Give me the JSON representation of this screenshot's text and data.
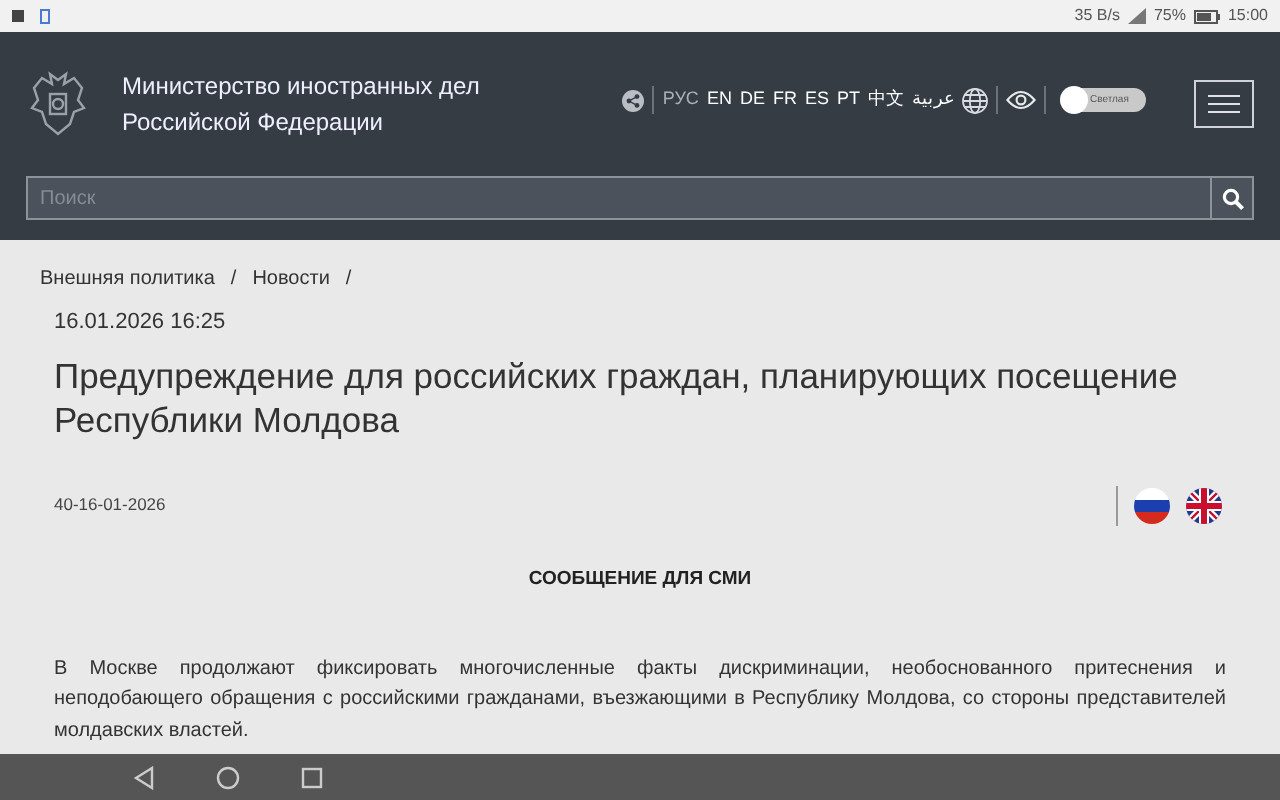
{
  "status_bar": {
    "speed": "35 B/s",
    "battery": "75%",
    "time": "15:00"
  },
  "header": {
    "title_lines": [
      "Министерство иностранных дел",
      "Российской Федерации"
    ],
    "languages": [
      {
        "label": "РУС",
        "selected": true
      },
      {
        "label": "EN",
        "selected": false
      },
      {
        "label": "DE",
        "selected": false
      },
      {
        "label": "FR",
        "selected": false
      },
      {
        "label": "ES",
        "selected": false
      },
      {
        "label": "PT",
        "selected": false
      },
      {
        "label": "中文",
        "selected": false
      },
      {
        "label": "عربية",
        "selected": false
      }
    ],
    "theme_toggle": {
      "label": "Светлая",
      "on": false
    },
    "search": {
      "placeholder": "Поиск"
    }
  },
  "breadcrumbs": [
    {
      "label": "Внешняя политика",
      "separator": "/"
    },
    {
      "label": "Новости",
      "separator": "/"
    }
  ],
  "article": {
    "date": "16.01.2026 16:25",
    "title": "Предупреждение для российских граждан, планирующих посещение Республики Молдова",
    "code": "40-16-01-2026",
    "heading": "СООБЩЕНИЕ ДЛЯ СМИ",
    "paragraph": "В Москве продолжают фиксировать многочисленные факты дискриминации, необоснованного притеснения и неподобающего обращения с российскими гражданами, въезжающими в Республику Молдова, со стороны представителей молдавских властей."
  }
}
